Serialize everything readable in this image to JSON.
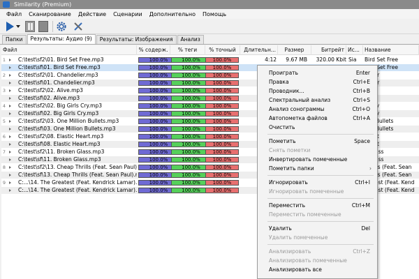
{
  "window": {
    "title": "Similarity (Premium)"
  },
  "menu": [
    "Файл",
    "Сканирование",
    "Действие",
    "Сценарии",
    "Дополнительно",
    "Помощь"
  ],
  "tabs": [
    {
      "label": "Папки",
      "active": false
    },
    {
      "label": "Результаты: Аудио (9)",
      "active": true
    },
    {
      "label": "Результаты: Изображения",
      "active": false
    },
    {
      "label": "Анализ",
      "active": false
    }
  ],
  "columns": {
    "file": "Файл",
    "content": "% содерж.",
    "tags": "% теги",
    "exact": "% точный",
    "duration": "Длительн...",
    "size": "Размер",
    "bitrate": "Битрейт",
    "artist": "Ис...",
    "name": "Название"
  },
  "rows": [
    {
      "file": "C:\\test\\sf2\\01. Bird Set Free.mp3",
      "content": "100.0%",
      "tags": "100.0%",
      "exact": "100.0%",
      "duration": "4:12",
      "size": "9.67 MB",
      "bitrate": "320.00 Kbit",
      "artist": "Sia",
      "name": "Bird Set Free",
      "group": "1"
    },
    {
      "file": "C:\\test\\sf\\01. Bird Set Free.mp3",
      "content": "100.0%",
      "tags": "100.0%",
      "exact": "100.0%",
      "duration": "4:12",
      "size": "9.67 MB",
      "bitrate": "320.00 Kbit",
      "artist": "Sia",
      "name": "Bird Set Free",
      "group": ""
    },
    {
      "file": "C:\\test\\sf2\\01. Chandelier.mp3",
      "content": "100.0%",
      "tags": "100.0%",
      "exact": "100.0%",
      "duration": "",
      "size": "",
      "bitrate": "",
      "artist": "",
      "name": "delier",
      "group": "2"
    },
    {
      "file": "C:\\test\\sf\\01. Chandelier.mp3",
      "content": "100.0%",
      "tags": "100.0%",
      "exact": "100.0%",
      "duration": "",
      "size": "",
      "bitrate": "",
      "artist": "",
      "name": "delier",
      "group": ""
    },
    {
      "file": "C:\\test\\sf2\\02. Alive.mp3",
      "content": "100.0%",
      "tags": "100.0%",
      "exact": "100.0%",
      "duration": "",
      "size": "",
      "bitrate": "",
      "artist": "",
      "name": "",
      "group": "3"
    },
    {
      "file": "C:\\test\\sf\\02. Alive.mp3",
      "content": "100.0%",
      "tags": "100.0%",
      "exact": "100.0%",
      "duration": "",
      "size": "",
      "bitrate": "",
      "artist": "",
      "name": "",
      "group": ""
    },
    {
      "file": "C:\\test\\sf2\\02. Big Girls Cry.mp3",
      "content": "100.0%",
      "tags": "100.0%",
      "exact": "100.0%",
      "duration": "",
      "size": "",
      "bitrate": "",
      "artist": "",
      "name": "ls Cry",
      "group": "4"
    },
    {
      "file": "C:\\test\\sf\\02. Big Girls Cry.mp3",
      "content": "100.0%",
      "tags": "100.0%",
      "exact": "100.0%",
      "duration": "",
      "size": "",
      "bitrate": "",
      "artist": "",
      "name": "ls Cry",
      "group": ""
    },
    {
      "file": "C:\\test\\sf2\\03. One Million Bullets.mp3",
      "content": "100.0%",
      "tags": "100.0%",
      "exact": "100.0%",
      "duration": "",
      "size": "",
      "bitrate": "",
      "artist": "",
      "name": "lion Bullets",
      "group": "5"
    },
    {
      "file": "C:\\test\\sf\\03. One Million Bullets.mp3",
      "content": "100.0%",
      "tags": "100.0%",
      "exact": "100.0%",
      "duration": "",
      "size": "",
      "bitrate": "",
      "artist": "",
      "name": "lion Bullets",
      "group": ""
    },
    {
      "file": "C:\\test\\sf2\\08. Elastic Heart.mp3",
      "content": "100.0%",
      "tags": "100.0%",
      "exact": "100.0%",
      "duration": "",
      "size": "",
      "bitrate": "",
      "artist": "",
      "name": "Heart",
      "group": "6"
    },
    {
      "file": "C:\\test\\sf\\08. Elastic Heart.mp3",
      "content": "100.0%",
      "tags": "100.0%",
      "exact": "100.0%",
      "duration": "",
      "size": "",
      "bitrate": "",
      "artist": "",
      "name": "Heart",
      "group": ""
    },
    {
      "file": "C:\\test\\sf2\\11. Broken Glass.mp3",
      "content": "100.0%",
      "tags": "100.0%",
      "exact": "100.0%",
      "duration": "",
      "size": "",
      "bitrate": "",
      "artist": "",
      "name": "n Glass",
      "group": "7"
    },
    {
      "file": "C:\\test\\sf\\11. Broken Glass.mp3",
      "content": "100.0%",
      "tags": "100.0%",
      "exact": "100.0%",
      "duration": "",
      "size": "",
      "bitrate": "",
      "artist": "",
      "name": "n Glass",
      "group": ""
    },
    {
      "file": "C:\\test\\sf2\\13. Cheap Thrills (Feat. Sean Paul).mp3",
      "content": "100.0%",
      "tags": "100.0%",
      "exact": "100.0%",
      "duration": "",
      "size": "",
      "bitrate": "",
      "artist": "",
      "name": "Thrills (Feat. Sean",
      "group": "8"
    },
    {
      "file": "C:\\test\\sf\\13. Cheap Thrills (Feat. Sean Paul).mp3",
      "content": "100.0%",
      "tags": "100.0%",
      "exact": "100.0%",
      "duration": "",
      "size": "",
      "bitrate": "",
      "artist": "",
      "name": "Thrills (Feat. Sean",
      "group": ""
    },
    {
      "file": "C:...\\14. The Greatest (Feat. Kendrick Lamar).mp3",
      "content": "100.0%",
      "tags": "100.0%",
      "exact": "100.0%",
      "duration": "",
      "size": "",
      "bitrate": "",
      "artist": "",
      "name": "reatest (Feat. Kend",
      "group": "9"
    },
    {
      "file": "C:...\\14. The Greatest (Feat. Kendrick Lamar).mp3",
      "content": "100.0%",
      "tags": "100.0%",
      "exact": "100.0%",
      "duration": "",
      "size": "",
      "bitrate": "",
      "artist": "",
      "name": "reatest (Feat. Kend",
      "group": ""
    }
  ],
  "context_menu": [
    {
      "label": "Проиграть",
      "shortcut": "Enter",
      "disabled": false
    },
    {
      "label": "Правка",
      "shortcut": "Ctrl+E",
      "disabled": false
    },
    {
      "label": "Проводник...",
      "shortcut": "Ctrl+B",
      "disabled": false
    },
    {
      "label": "Спектральный анализ",
      "shortcut": "Ctrl+S",
      "disabled": false
    },
    {
      "label": "Анализ сонограммы",
      "shortcut": "Ctrl+O",
      "disabled": false
    },
    {
      "label": "Автопометка файлов",
      "shortcut": "Ctrl+A",
      "disabled": false
    },
    {
      "label": "Очистить",
      "shortcut": "",
      "disabled": false
    },
    {
      "divider": true
    },
    {
      "label": "Пометить",
      "shortcut": "Space",
      "disabled": false
    },
    {
      "label": "Снять пометки",
      "shortcut": "",
      "disabled": true
    },
    {
      "label": "Инвертировать помеченные",
      "shortcut": "",
      "disabled": false
    },
    {
      "label": "Пометить папки",
      "shortcut": "",
      "disabled": false,
      "submenu": true
    },
    {
      "divider": true
    },
    {
      "label": "Игнорировать",
      "shortcut": "Ctrl+I",
      "disabled": false
    },
    {
      "label": "Игнорировать помеченные",
      "shortcut": "",
      "disabled": true
    },
    {
      "divider": true
    },
    {
      "label": "Переместить",
      "shortcut": "Ctrl+M",
      "disabled": false
    },
    {
      "label": "Переместить помеченные",
      "shortcut": "",
      "disabled": true
    },
    {
      "divider": true
    },
    {
      "label": "Удалить",
      "shortcut": "Del",
      "disabled": false
    },
    {
      "label": "Удалить помеченные",
      "shortcut": "",
      "disabled": true
    },
    {
      "divider": true
    },
    {
      "label": "Анализировать",
      "shortcut": "Ctrl+Z",
      "disabled": true
    },
    {
      "label": "Анализировать помеченные",
      "shortcut": "",
      "disabled": true
    },
    {
      "label": "Анализировать все",
      "shortcut": "",
      "disabled": false
    }
  ],
  "colors": {
    "content_bar": "#6f6ad4",
    "tags_bar": "#55d05a",
    "exact_bar": "#e86f6f",
    "selection": "#cfe3f7"
  },
  "icons": [
    "play-icon",
    "dropdown-arrow-icon",
    "pause-icon",
    "stop-icon",
    "gear-icon",
    "tools-icon",
    "expand-arrow-icon",
    "submenu-arrow-icon"
  ]
}
